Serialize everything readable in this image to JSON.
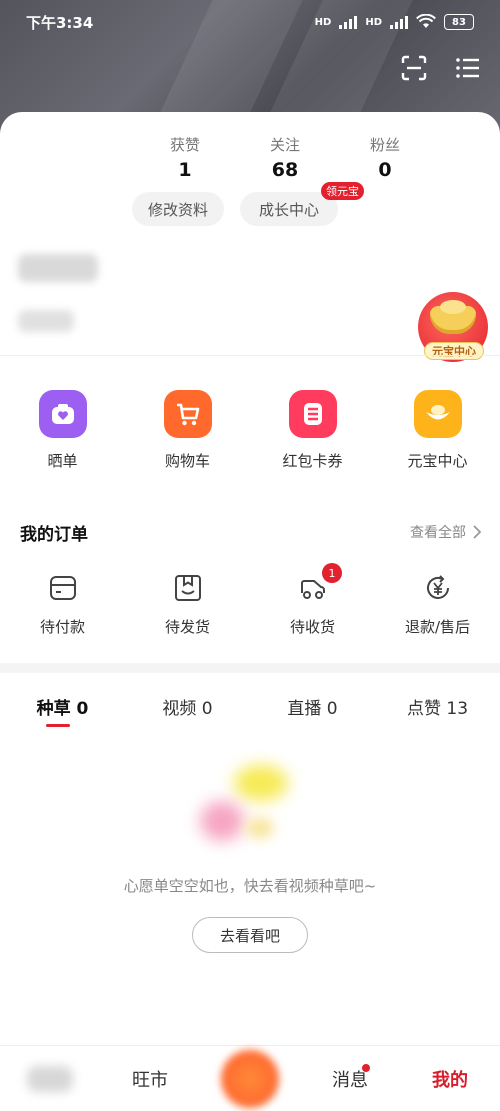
{
  "status_bar": {
    "time": "下午3:34",
    "network_label": "HD",
    "battery": "83"
  },
  "profile": {
    "stats": [
      {
        "label": "获赞",
        "value": "1"
      },
      {
        "label": "关注",
        "value": "68"
      },
      {
        "label": "粉丝",
        "value": "0"
      }
    ],
    "edit_profile": "修改资料",
    "growth_center": "成长中心",
    "growth_badge": "领元宝",
    "yuanbao_float_label": "元宝中心"
  },
  "tools": [
    {
      "label": "晒单",
      "icon": "camera-heart-icon",
      "color": "#9c5ff2"
    },
    {
      "label": "购物车",
      "icon": "shopping-cart-icon",
      "color": "#ff6a2c"
    },
    {
      "label": "红包卡券",
      "icon": "red-packet-icon",
      "color": "#ff3b5e"
    },
    {
      "label": "元宝中心",
      "icon": "ingot-icon",
      "color": "#ffb31a"
    }
  ],
  "orders": {
    "title": "我的订单",
    "view_all": "查看全部",
    "items": [
      {
        "label": "待付款",
        "icon": "wallet-card-icon",
        "badge": ""
      },
      {
        "label": "待发货",
        "icon": "box-icon",
        "badge": ""
      },
      {
        "label": "待收货",
        "icon": "delivery-truck-icon",
        "badge": "1"
      },
      {
        "label": "退款/售后",
        "icon": "refund-yuan-icon",
        "badge": ""
      }
    ]
  },
  "content_tabs": [
    {
      "label": "种草 0",
      "active": true
    },
    {
      "label": "视频 0",
      "active": false
    },
    {
      "label": "直播 0",
      "active": false
    },
    {
      "label": "点赞 13",
      "active": false
    }
  ],
  "empty_state": {
    "message": "心愿单空空如也，快去看视频种草吧~",
    "button": "去看看吧"
  },
  "bottom_nav": [
    {
      "label": "",
      "active": false
    },
    {
      "label": "旺市",
      "active": false
    },
    {
      "label": "",
      "active": false
    },
    {
      "label": "消息",
      "active": false
    },
    {
      "label": "我的",
      "active": true
    }
  ],
  "colors": {
    "accent": "#e2202e",
    "header_bg": "#5a5a63"
  }
}
